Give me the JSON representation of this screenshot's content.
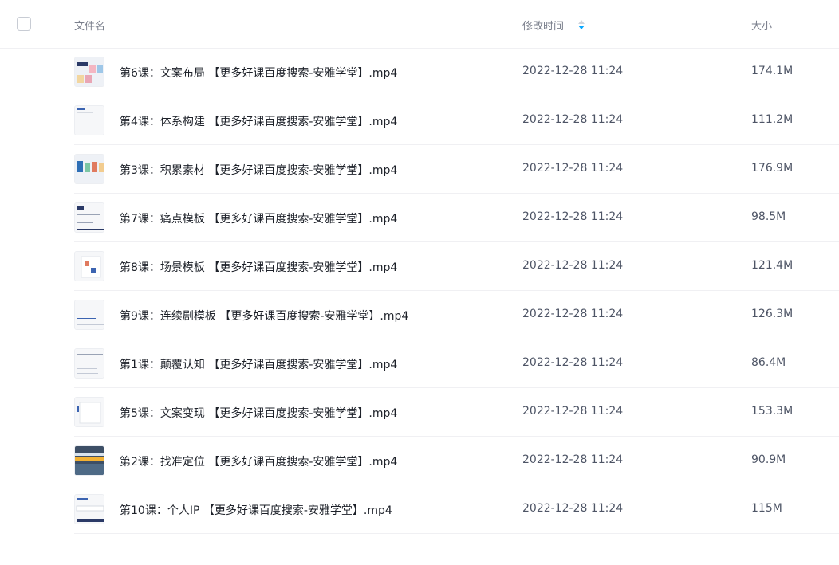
{
  "header": {
    "name_label": "文件名",
    "time_label": "修改时间",
    "size_label": "大小",
    "sort_icon": "sort-descending-icon"
  },
  "files": [
    {
      "name": "第6课：文案布局 【更多好课百度搜索-安雅学堂】.mp4",
      "time": "2022-12-28 11:24",
      "size": "174.1M",
      "thumb": "video-thumbnail"
    },
    {
      "name": "第4课：体系构建 【更多好课百度搜索-安雅学堂】.mp4",
      "time": "2022-12-28 11:24",
      "size": "111.2M",
      "thumb": "video-thumbnail"
    },
    {
      "name": "第3课：积累素材 【更多好课百度搜索-安雅学堂】.mp4",
      "time": "2022-12-28 11:24",
      "size": "176.9M",
      "thumb": "video-thumbnail"
    },
    {
      "name": "第7课：痛点模板 【更多好课百度搜索-安雅学堂】.mp4",
      "time": "2022-12-28 11:24",
      "size": "98.5M",
      "thumb": "video-thumbnail"
    },
    {
      "name": "第8课：场景模板 【更多好课百度搜索-安雅学堂】.mp4",
      "time": "2022-12-28 11:24",
      "size": "121.4M",
      "thumb": "video-thumbnail"
    },
    {
      "name": "第9课：连续剧模板 【更多好课百度搜索-安雅学堂】.mp4",
      "time": "2022-12-28 11:24",
      "size": "126.3M",
      "thumb": "video-thumbnail"
    },
    {
      "name": "第1课：颠覆认知 【更多好课百度搜索-安雅学堂】.mp4",
      "time": "2022-12-28 11:24",
      "size": "86.4M",
      "thumb": "video-thumbnail"
    },
    {
      "name": "第5课：文案变现 【更多好课百度搜索-安雅学堂】.mp4",
      "time": "2022-12-28 11:24",
      "size": "153.3M",
      "thumb": "video-thumbnail"
    },
    {
      "name": "第2课：找准定位 【更多好课百度搜索-安雅学堂】.mp4",
      "time": "2022-12-28 11:24",
      "size": "90.9M",
      "thumb": "video-thumbnail"
    },
    {
      "name": "第10课：个人IP 【更多好课百度搜索-安雅学堂】.mp4",
      "time": "2022-12-28 11:24",
      "size": "115M",
      "thumb": "video-thumbnail"
    }
  ],
  "colors": {
    "accent": "#06a7ff",
    "text_primary": "#1d2129",
    "text_secondary": "#4e5566",
    "divider": "#f0f0f3"
  }
}
